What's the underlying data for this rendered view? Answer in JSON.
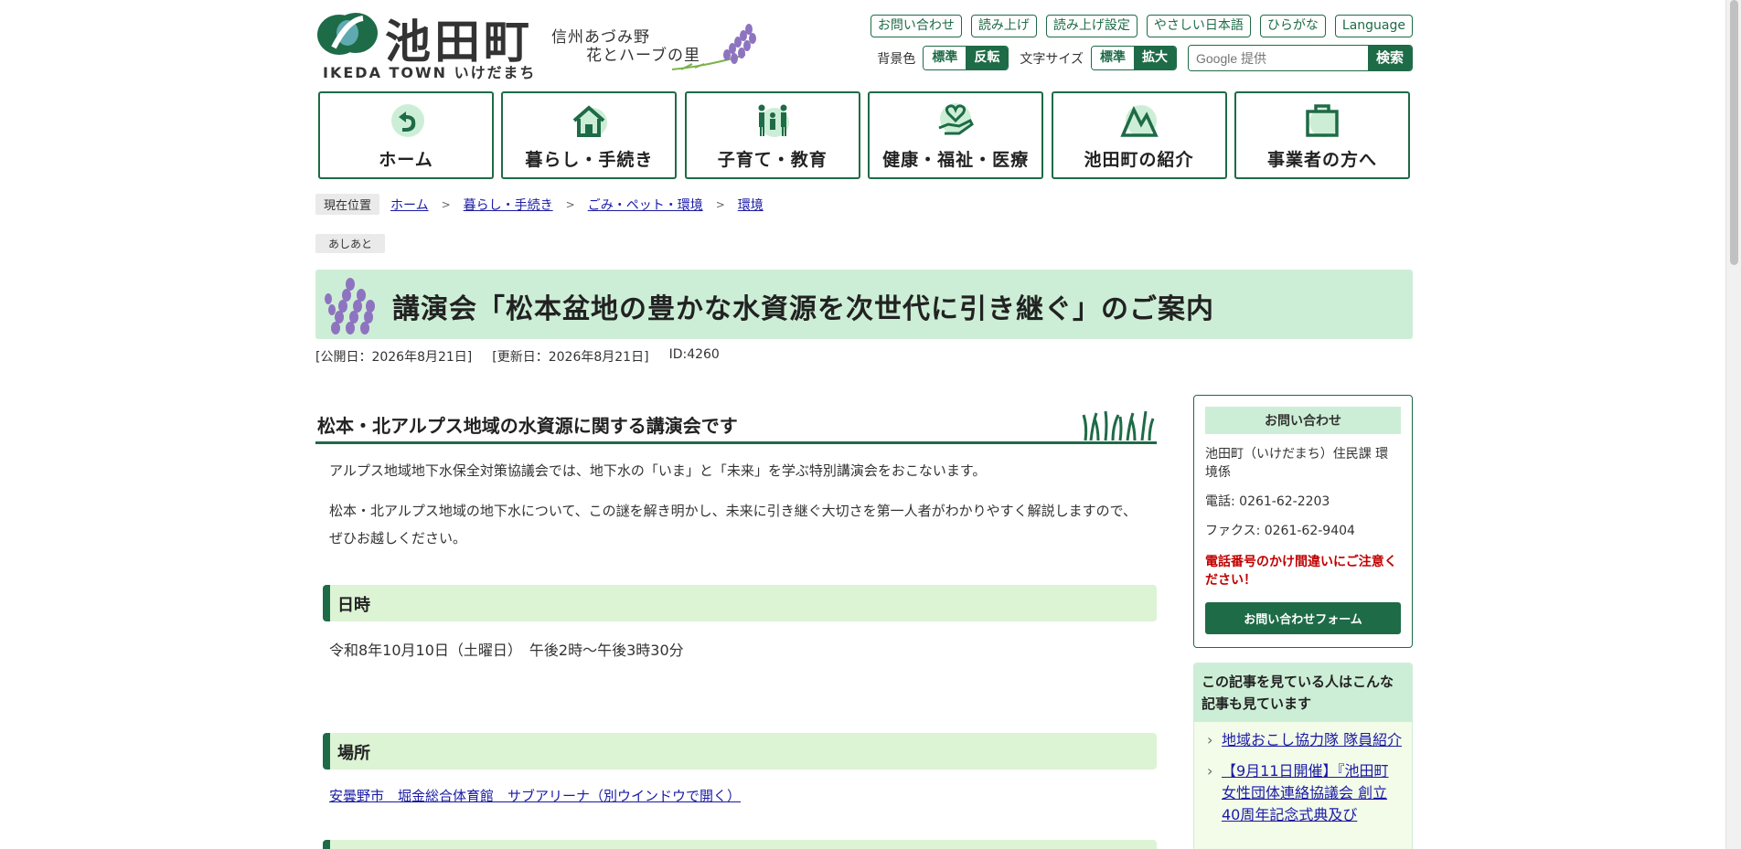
{
  "header": {
    "logo_name": "池田町",
    "logo_sub": "IKEDA TOWN いけだまち",
    "tagline_1": "信州あづみ野",
    "tagline_2": "花とハーブの里",
    "util_links": [
      "お問い合わせ",
      "読み上げ",
      "読み上げ設定",
      "やさしい日本語",
      "ひらがな",
      "Language"
    ],
    "bg_label": "背景色",
    "bg_standard": "標準",
    "bg_invert": "反転",
    "font_label": "文字サイズ",
    "font_standard": "標準",
    "font_large": "拡大",
    "search_placeholder": "Google 提供",
    "search_button": "検索"
  },
  "nav": [
    {
      "label": "ホーム",
      "icon": "return-arrow-icon"
    },
    {
      "label": "暮らし・手続き",
      "icon": "house-icon"
    },
    {
      "label": "子育て・教育",
      "icon": "family-icon"
    },
    {
      "label": "健康・福祉・医療",
      "icon": "heart-hand-icon"
    },
    {
      "label": "池田町の紹介",
      "icon": "mountain-icon"
    },
    {
      "label": "事業者の方へ",
      "icon": "briefcase-icon"
    }
  ],
  "breadcrumb": {
    "tag": "現在位置",
    "items": [
      "ホーム",
      "暮らし・手続き",
      "ごみ・ペット・環境",
      "環境"
    ]
  },
  "ashiato": "あしあと",
  "page": {
    "title": "講演会「松本盆地の豊かな水資源を次世代に引き継ぐ」のご案内",
    "published": "[公開日：2026年8月21日]",
    "updated": "[更新日：2026年8月21日]",
    "id": "ID:4260"
  },
  "article": {
    "heading": "松本・北アルプス地域の水資源に関する講演会です",
    "para1": "アルプス地域地下水保全対策協議会では、地下水の「いま」と「未来」を学ぶ特別講演会をおこないます。",
    "para2": "松本・北アルプス地域の地下水について、この謎を解き明かし、未来に引き継ぐ大切さを第一人者がわかりやすく解説しますので、ぜひお越しください。",
    "section_datetime": "日時",
    "datetime": "令和8年10月10日（土曜日）　午後2時～午後3時30分",
    "section_place": "場所",
    "place_link": "安曇野市　堀金総合体育館　サブアリーナ（別ウインドウで開く）"
  },
  "sidebar": {
    "contact_heading": "お問い合わせ",
    "contact_org": "池田町（いけだまち）住民課 環境係",
    "phone": "電話: 0261-62-2203",
    "fax": "ファクス: 0261-62-9404",
    "warning": "電話番号のかけ間違いにご注意ください！",
    "form_button": "お問い合わせフォーム",
    "related_heading": "この記事を見ている人はこんな記事も見ています",
    "related_links": [
      "地域おこし協力隊 隊員紹介",
      "【9月11日開催】『池田町女性団体連絡協議会 創立40周年記念式典及び"
    ]
  },
  "colors": {
    "brand_green": "#1e6b47",
    "light_green": "#cdeed6",
    "warning_red": "#c00000"
  }
}
